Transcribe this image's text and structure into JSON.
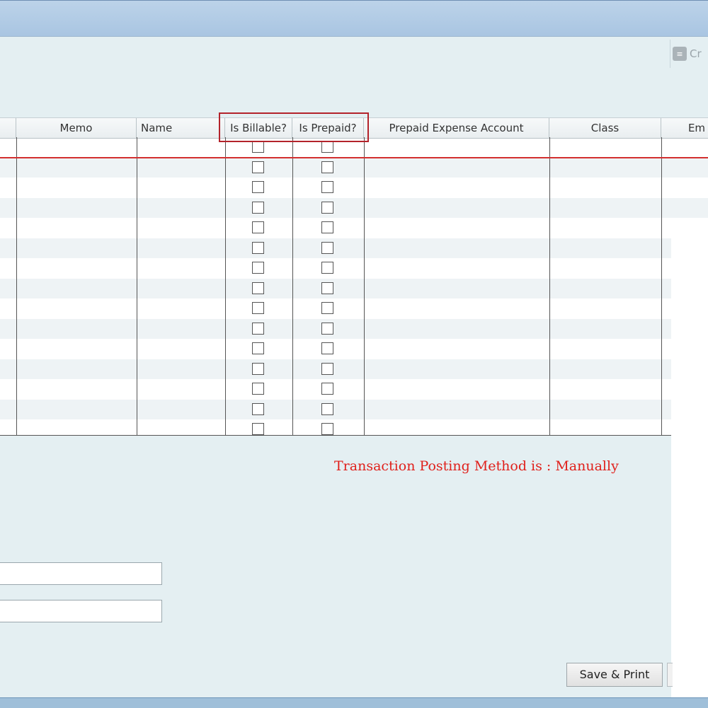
{
  "toolbar": {
    "create_label": "Cr",
    "create_icon": "form-icon"
  },
  "grid": {
    "columns": [
      {
        "key": "col0",
        "label": ""
      },
      {
        "key": "memo",
        "label": "Memo"
      },
      {
        "key": "name",
        "label": "Name"
      },
      {
        "key": "billable",
        "label": "Is Billable?"
      },
      {
        "key": "prepaid",
        "label": "Is Prepaid?"
      },
      {
        "key": "prepaid_account",
        "label": "Prepaid Expense Account"
      },
      {
        "key": "class",
        "label": "Class"
      },
      {
        "key": "em",
        "label": "Em"
      }
    ],
    "row_count": 15
  },
  "status_message": "Transaction Posting Method is : Manually",
  "buttons": {
    "save_print": "Save & Print"
  },
  "colors": {
    "accent_red": "#e0201b",
    "highlight_box": "#b3232b",
    "background": "#e4eff2"
  }
}
